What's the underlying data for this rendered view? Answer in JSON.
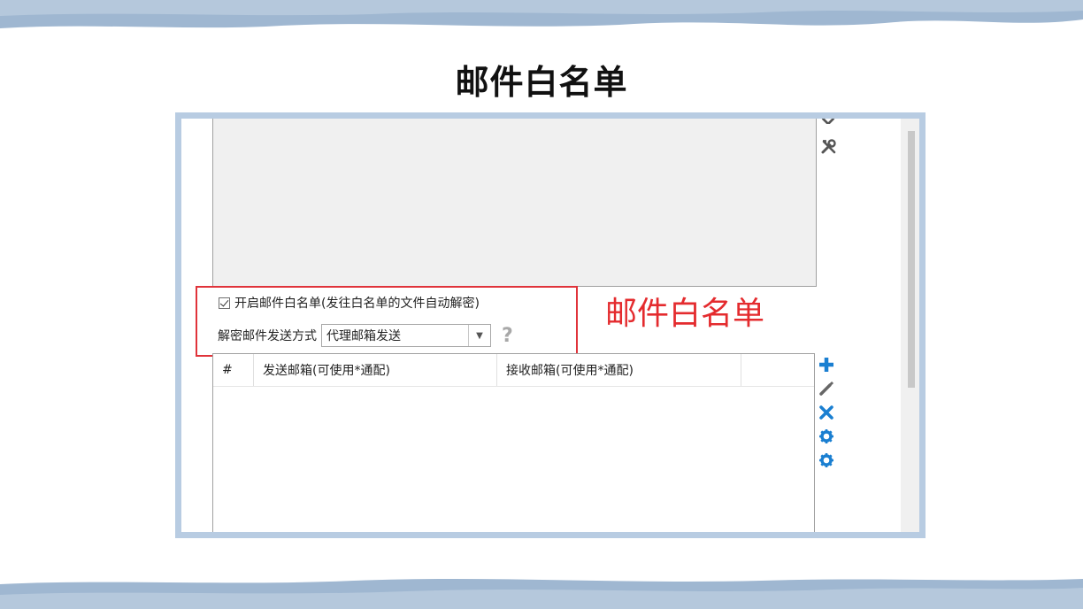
{
  "slide": {
    "title": "邮件白名单"
  },
  "settings": {
    "enable_checkbox_label": "开启邮件白名单(发往白名单的文件自动解密)",
    "enable_checked": true,
    "method_label": "解密邮件发送方式",
    "method_value": "代理邮箱发送",
    "help_icon": "?"
  },
  "annotation": {
    "text": "邮件白名单",
    "color": "#e42b2e"
  },
  "table": {
    "columns": [
      "#",
      "发送邮箱(可使用*通配)",
      "接收邮箱(可使用*通配)",
      ""
    ]
  },
  "side_actions": [
    "add-icon",
    "edit-icon",
    "delete-icon",
    "settings-icon",
    "settings-icon"
  ],
  "colors": {
    "frame": "#b8cce2",
    "accent_blue": "#1a7fd1",
    "highlight_red": "#e0333a"
  }
}
